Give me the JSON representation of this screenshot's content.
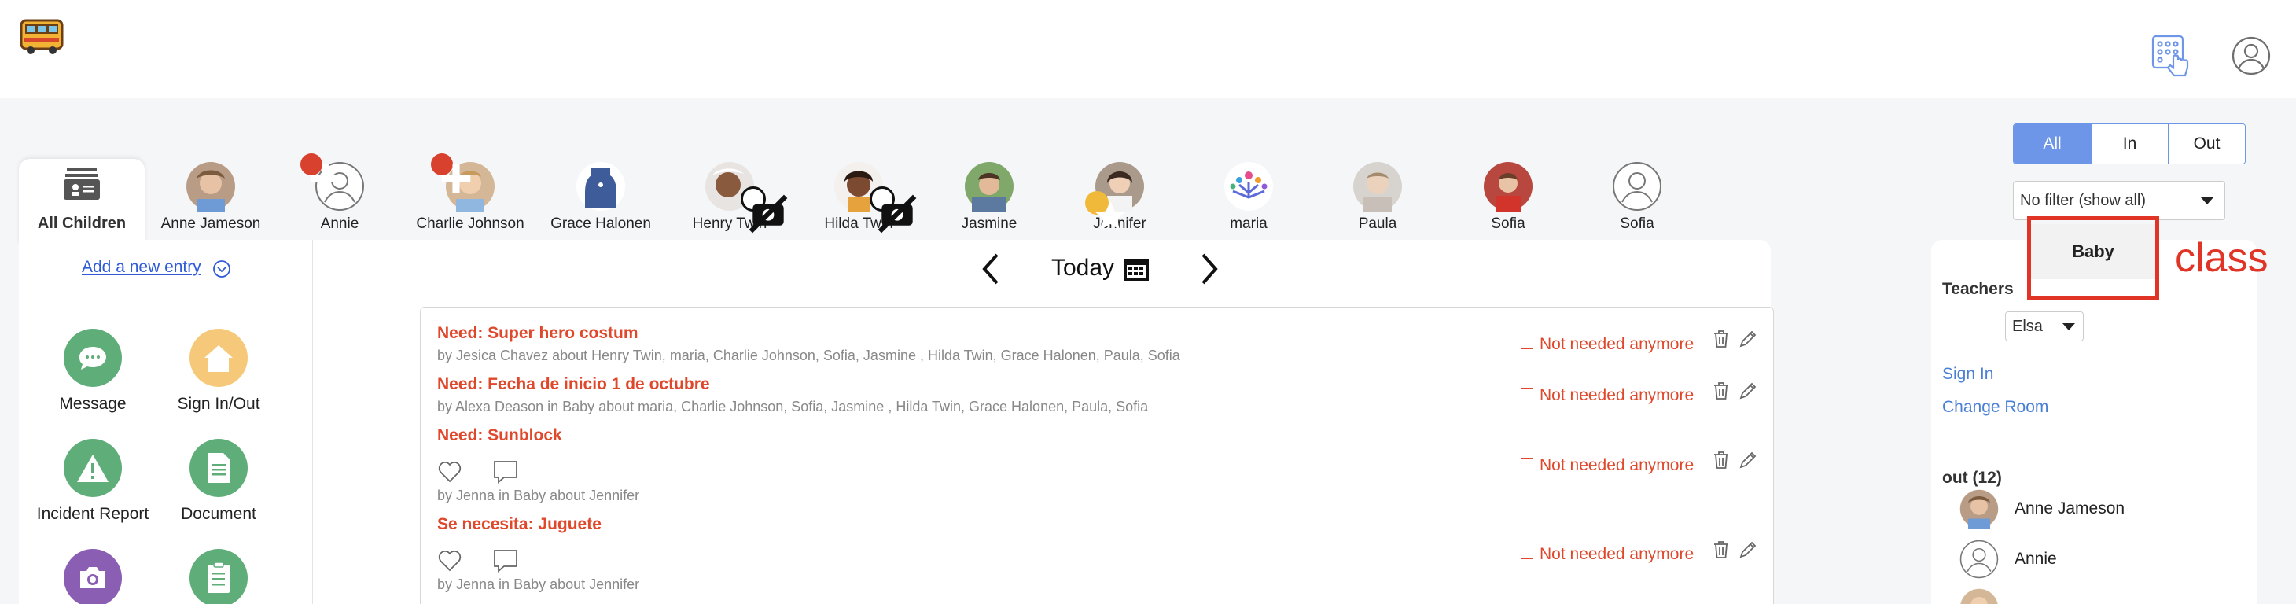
{
  "header": {
    "logo_icon": "school-bus-logo-icon",
    "keypad_icon": "keypad-tap-icon",
    "account_icon": "user-account-icon"
  },
  "children_bar": {
    "all_children_label": "All Children",
    "children": [
      {
        "name": "Anne Jameson",
        "photo": true,
        "badge": null
      },
      {
        "name": "Annie",
        "photo": false,
        "badge": "add"
      },
      {
        "name": "Charlie Johnson",
        "photo": true,
        "badge": "add"
      },
      {
        "name": "Grace Halonen",
        "photo": true,
        "badge": null
      },
      {
        "name": "Henry Twin",
        "photo": true,
        "badge": "no-photo"
      },
      {
        "name": "Hilda Twin",
        "photo": true,
        "badge": "no-photo"
      },
      {
        "name": "Jasmine",
        "photo": true,
        "badge": null
      },
      {
        "name": "Jennifer",
        "photo": true,
        "badge": "star"
      },
      {
        "name": "maria",
        "photo": "logo",
        "badge": null
      },
      {
        "name": "Paula",
        "photo": true,
        "badge": null
      },
      {
        "name": "Sofia",
        "photo": true,
        "badge": null
      },
      {
        "name": "Sofia",
        "photo": false,
        "badge": null
      }
    ]
  },
  "filters": {
    "status_buttons": [
      "All",
      "In",
      "Out"
    ],
    "active": "All",
    "filter_select_value": "No filter (show all)"
  },
  "left_panel": {
    "add_entry_label": "Add a new entry",
    "actions": [
      {
        "label": "Message",
        "icon": "message-bubble-icon",
        "color": "#5fae7a"
      },
      {
        "label": "Sign In/Out",
        "icon": "home-icon",
        "color": "#f6c97a"
      },
      {
        "label": "Incident Report",
        "icon": "warning-icon",
        "color": "#5fae7a"
      },
      {
        "label": "Document",
        "icon": "document-icon",
        "color": "#5fae7a"
      },
      {
        "label": "",
        "icon": "camera-icon",
        "color": "#8a5fb3"
      },
      {
        "label": "",
        "icon": "checklist-icon",
        "color": "#5fae7a"
      }
    ]
  },
  "date_nav": {
    "label": "Today"
  },
  "feed": {
    "not_needed_label": "Not needed anymore",
    "entries": [
      {
        "title": "Need: Super hero costum",
        "by": "by Jesica Chavez about Henry Twin, maria, Charlie Johnson, Sofia, Jasmine , Hilda Twin, Grace Halonen, Paula, Sofia",
        "social": false
      },
      {
        "title": "Need: Fecha de inicio 1 de octubre",
        "by": "by Alexa Deason in Baby about maria, Charlie Johnson, Sofia, Jasmine , Hilda Twin, Grace Halonen, Paula, Sofia",
        "social": false
      },
      {
        "title": "Need: Sunblock",
        "by": "by Jenna in Baby about Jennifer",
        "social": true
      },
      {
        "title": "Se necesita: Juguete",
        "by": "by Jenna in Baby about Jennifer",
        "social": true
      }
    ]
  },
  "right_panel": {
    "class_tab": "Baby",
    "annotation_label": "class",
    "teachers_label": "Teachers",
    "teacher_select": "Elsa",
    "sign_in_link": "Sign In",
    "change_room_link": "Change Room",
    "out_label": "out (12)",
    "people": [
      {
        "name": "Anne Jameson",
        "photo": true
      },
      {
        "name": "Annie",
        "photo": false
      },
      {
        "name": "",
        "photo": true
      }
    ]
  },
  "colors": {
    "accent": "#6d96e8",
    "alert": "#e0482b",
    "annotation": "#e03426",
    "link": "#2f5bd8"
  }
}
